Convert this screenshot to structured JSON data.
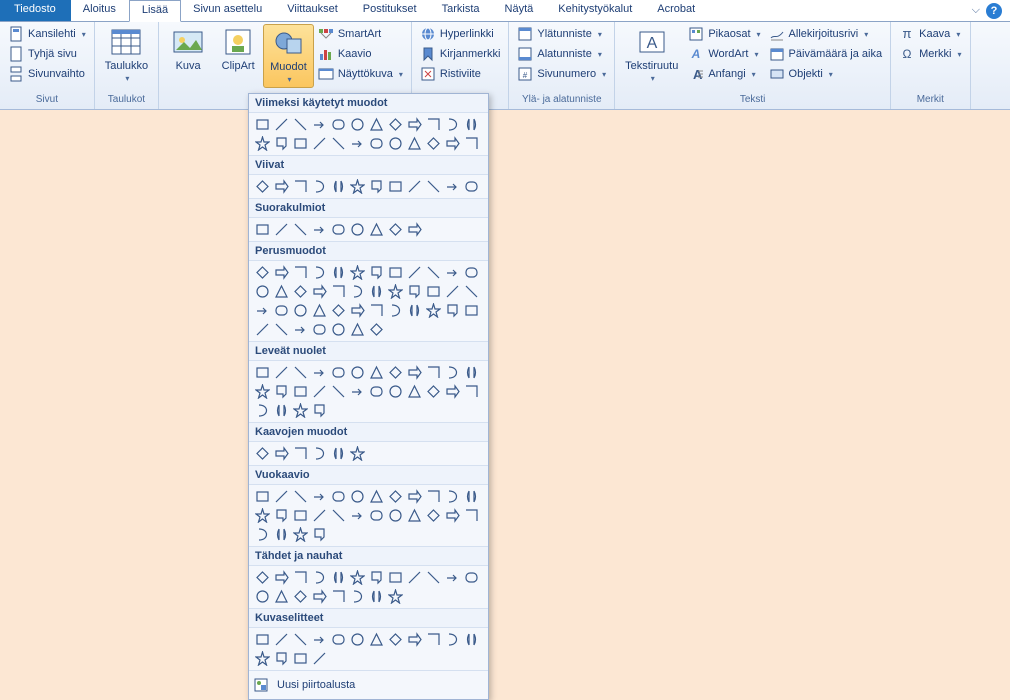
{
  "tabs": {
    "file": "Tiedosto",
    "items": [
      "Aloitus",
      "Lisää",
      "Sivun asettelu",
      "Viittaukset",
      "Postitukset",
      "Tarkista",
      "Näytä",
      "Kehitystyökalut",
      "Acrobat"
    ],
    "active_index": 1
  },
  "ribbon": {
    "groups": {
      "sivut": {
        "label": "Sivut",
        "items": [
          "Kansilehti",
          "Tyhjä sivu",
          "Sivunvaihto"
        ]
      },
      "taulukot": {
        "label": "Taulukot",
        "big": "Taulukko"
      },
      "kuvat": {
        "label": "Kuvat",
        "kuva": "Kuva",
        "clipart": "ClipArt",
        "muodot": "Muodot",
        "smartart": "SmartArt",
        "kaavio": "Kaavio",
        "nayttokuva": "Näyttökuva"
      },
      "linkit": {
        "label": "Linkit",
        "hyperlinkki": "Hyperlinkki",
        "kirjanmerkki": "Kirjanmerkki",
        "ristiviite": "Ristiviite"
      },
      "yla": {
        "label": "Ylä- ja alatunniste",
        "ylatunniste": "Ylätunniste",
        "alatunniste": "Alatunniste",
        "sivunumero": "Sivunumero"
      },
      "teksti": {
        "label": "Teksti",
        "tekstiruutu": "Tekstiruutu",
        "pikaosat": "Pikaosat",
        "wordart": "WordArt",
        "anfangi": "Anfangi",
        "allekirjoitusrivi": "Allekirjoitusrivi",
        "paivamaara": "Päivämäärä ja aika",
        "objekti": "Objekti"
      },
      "merkit": {
        "label": "Merkit",
        "kaava": "Kaava",
        "merkki": "Merkki"
      }
    }
  },
  "shapes_dropdown": {
    "sections": [
      {
        "title": "Viimeksi käytetyt muodot",
        "count": 24
      },
      {
        "title": "Viivat",
        "count": 12
      },
      {
        "title": "Suorakulmiot",
        "count": 9
      },
      {
        "title": "Perusmuodot",
        "count": 43
      },
      {
        "title": "Leveät nuolet",
        "count": 28
      },
      {
        "title": "Kaavojen muodot",
        "count": 6
      },
      {
        "title": "Vuokaavio",
        "count": 28
      },
      {
        "title": "Tähdet ja nauhat",
        "count": 20
      },
      {
        "title": "Kuvaselitteet",
        "count": 16
      }
    ],
    "footer": "Uusi piirtoalusta"
  }
}
